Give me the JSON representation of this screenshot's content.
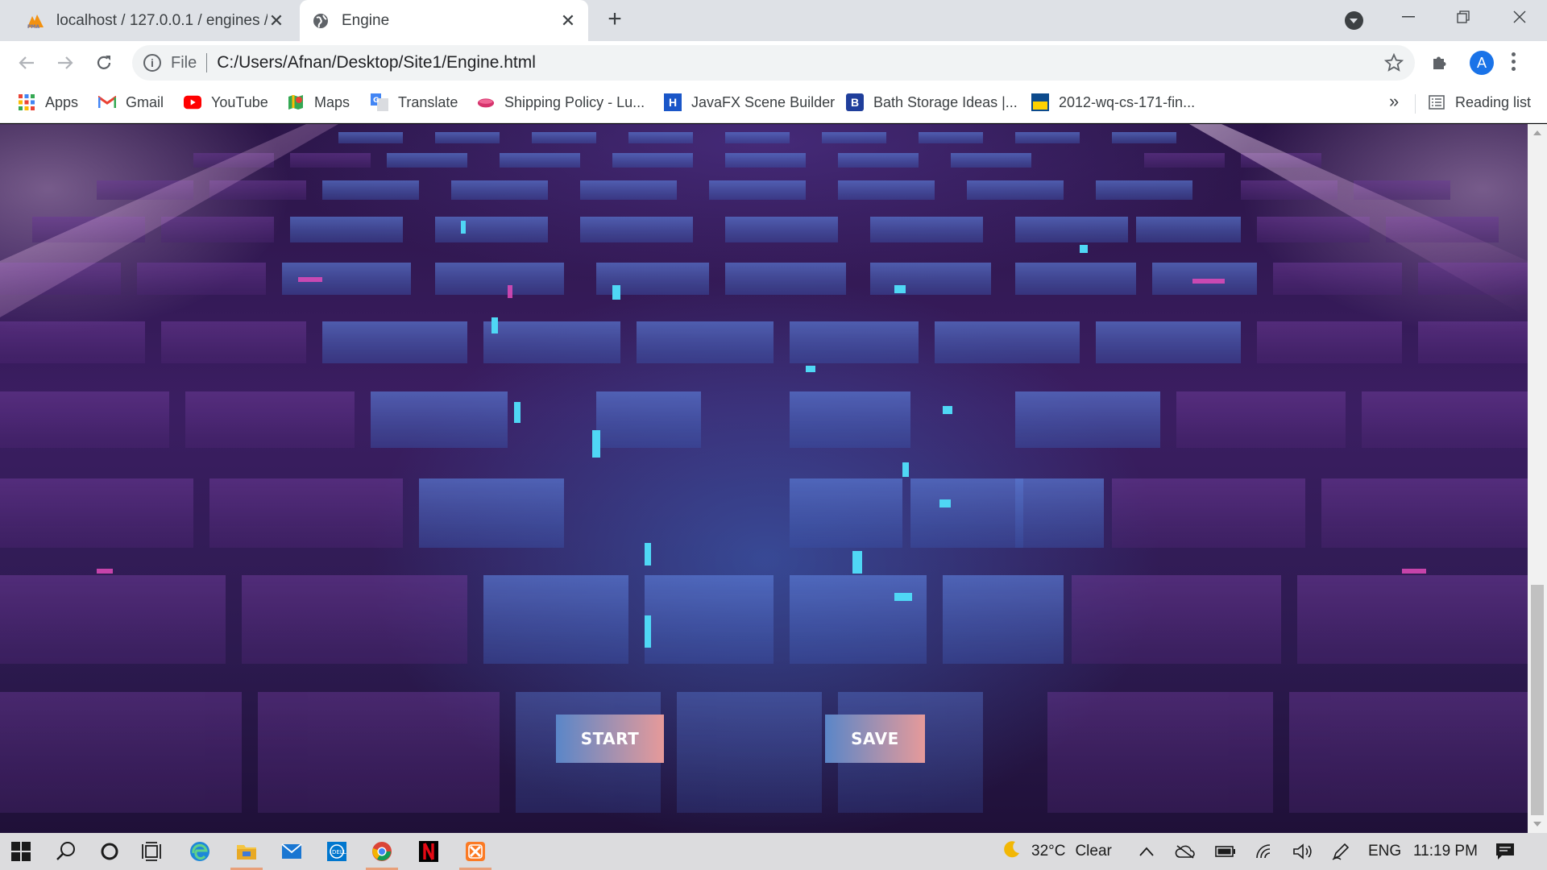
{
  "browser": {
    "tabs": [
      {
        "title": "localhost / 127.0.0.1 / engines / e",
        "favicon": "phpmyadmin-icon",
        "active": false
      },
      {
        "title": "Engine",
        "favicon": "globe-icon",
        "active": true
      }
    ],
    "address": {
      "scheme_label": "File",
      "url": "C:/Users/Afnan/Desktop/Site1/Engine.html"
    },
    "profile_initial": "A",
    "bookmarks": [
      {
        "label": "Apps",
        "icon": "apps-grid-icon"
      },
      {
        "label": "Gmail",
        "icon": "gmail-icon"
      },
      {
        "label": "YouTube",
        "icon": "youtube-icon"
      },
      {
        "label": "Maps",
        "icon": "maps-icon"
      },
      {
        "label": "Translate",
        "icon": "translate-icon"
      },
      {
        "label": "Shipping Policy - Lu...",
        "icon": "lipstick-icon"
      },
      {
        "label": "JavaFX Scene Builder",
        "icon": "h-letter-icon"
      },
      {
        "label": "Bath Storage Ideas |...",
        "icon": "b-letter-icon"
      },
      {
        "label": "2012-wq-cs-171-fin...",
        "icon": "uci-ics-icon"
      }
    ],
    "bookmarks_overflow": "»",
    "reading_list": "Reading list"
  },
  "page": {
    "start_label": "START",
    "save_label": "SAVE",
    "button_gradient": [
      "#5a86c8",
      "#e69a9a"
    ]
  },
  "taskbar": {
    "weather_temp": "32°C",
    "weather_text": "Clear",
    "language": "ENG",
    "time": "11:19 PM"
  }
}
